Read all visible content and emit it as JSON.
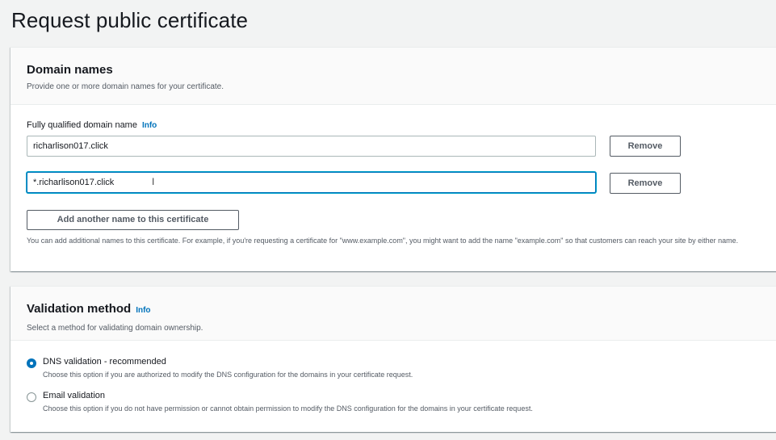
{
  "page": {
    "title": "Request public certificate"
  },
  "domains": {
    "heading": "Domain names",
    "description": "Provide one or more domain names for your certificate.",
    "field_label": "Fully qualified domain name",
    "info_label": "Info",
    "entries": [
      {
        "value": "richarlison017.click",
        "remove_label": "Remove"
      },
      {
        "value": "*.richarlison017.click",
        "remove_label": "Remove"
      }
    ],
    "cursor_glyph": "I",
    "add_button_label": "Add another name to this certificate",
    "help_text": "You can add additional names to this certificate. For example, if you're requesting a certificate for \"www.example.com\", you might want to add the name \"example.com\" so that customers can reach your site by either name."
  },
  "validation": {
    "heading": "Validation method",
    "info_label": "Info",
    "description": "Select a method for validating domain ownership.",
    "options": [
      {
        "label": "DNS validation - recommended",
        "description": "Choose this option if you are authorized to modify the DNS configuration for the domains in your certificate request.",
        "selected": true
      },
      {
        "label": "Email validation",
        "description": "Choose this option if you do not have permission or cannot obtain permission to modify the DNS configuration for the domains in your certificate request.",
        "selected": false
      }
    ]
  },
  "colors": {
    "accent": "#0073bb",
    "focus_ring": "#00a1c9",
    "text": "#16191f",
    "muted_text": "#545b64",
    "background": "#f2f3f3"
  }
}
